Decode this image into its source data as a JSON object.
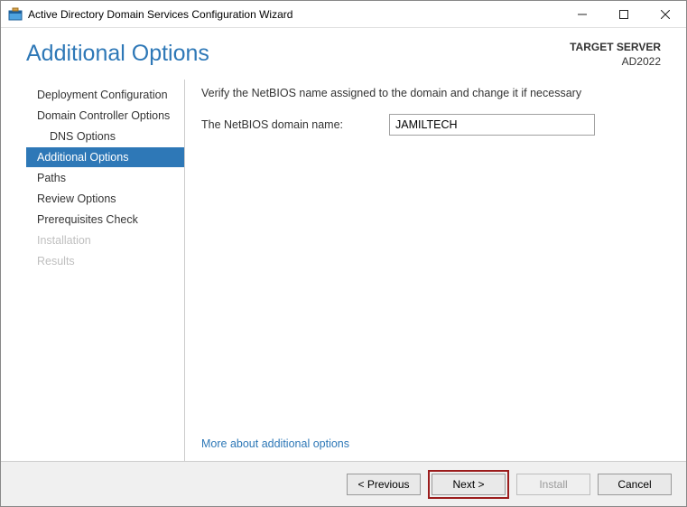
{
  "titlebar": {
    "title": "Active Directory Domain Services Configuration Wizard"
  },
  "header": {
    "page_title": "Additional Options",
    "target_label": "TARGET SERVER",
    "target_value": "AD2022"
  },
  "sidebar": {
    "items": [
      {
        "label": "Deployment Configuration"
      },
      {
        "label": "Domain Controller Options"
      },
      {
        "label": "DNS Options"
      },
      {
        "label": "Additional Options"
      },
      {
        "label": "Paths"
      },
      {
        "label": "Review Options"
      },
      {
        "label": "Prerequisites Check"
      },
      {
        "label": "Installation"
      },
      {
        "label": "Results"
      }
    ]
  },
  "content": {
    "instruction": "Verify the NetBIOS name assigned to the domain and change it if necessary",
    "field_label": "The NetBIOS domain name:",
    "field_value": "JAMILTECH",
    "more_link": "More about additional options"
  },
  "footer": {
    "previous": "< Previous",
    "next": "Next >",
    "install": "Install",
    "cancel": "Cancel"
  }
}
